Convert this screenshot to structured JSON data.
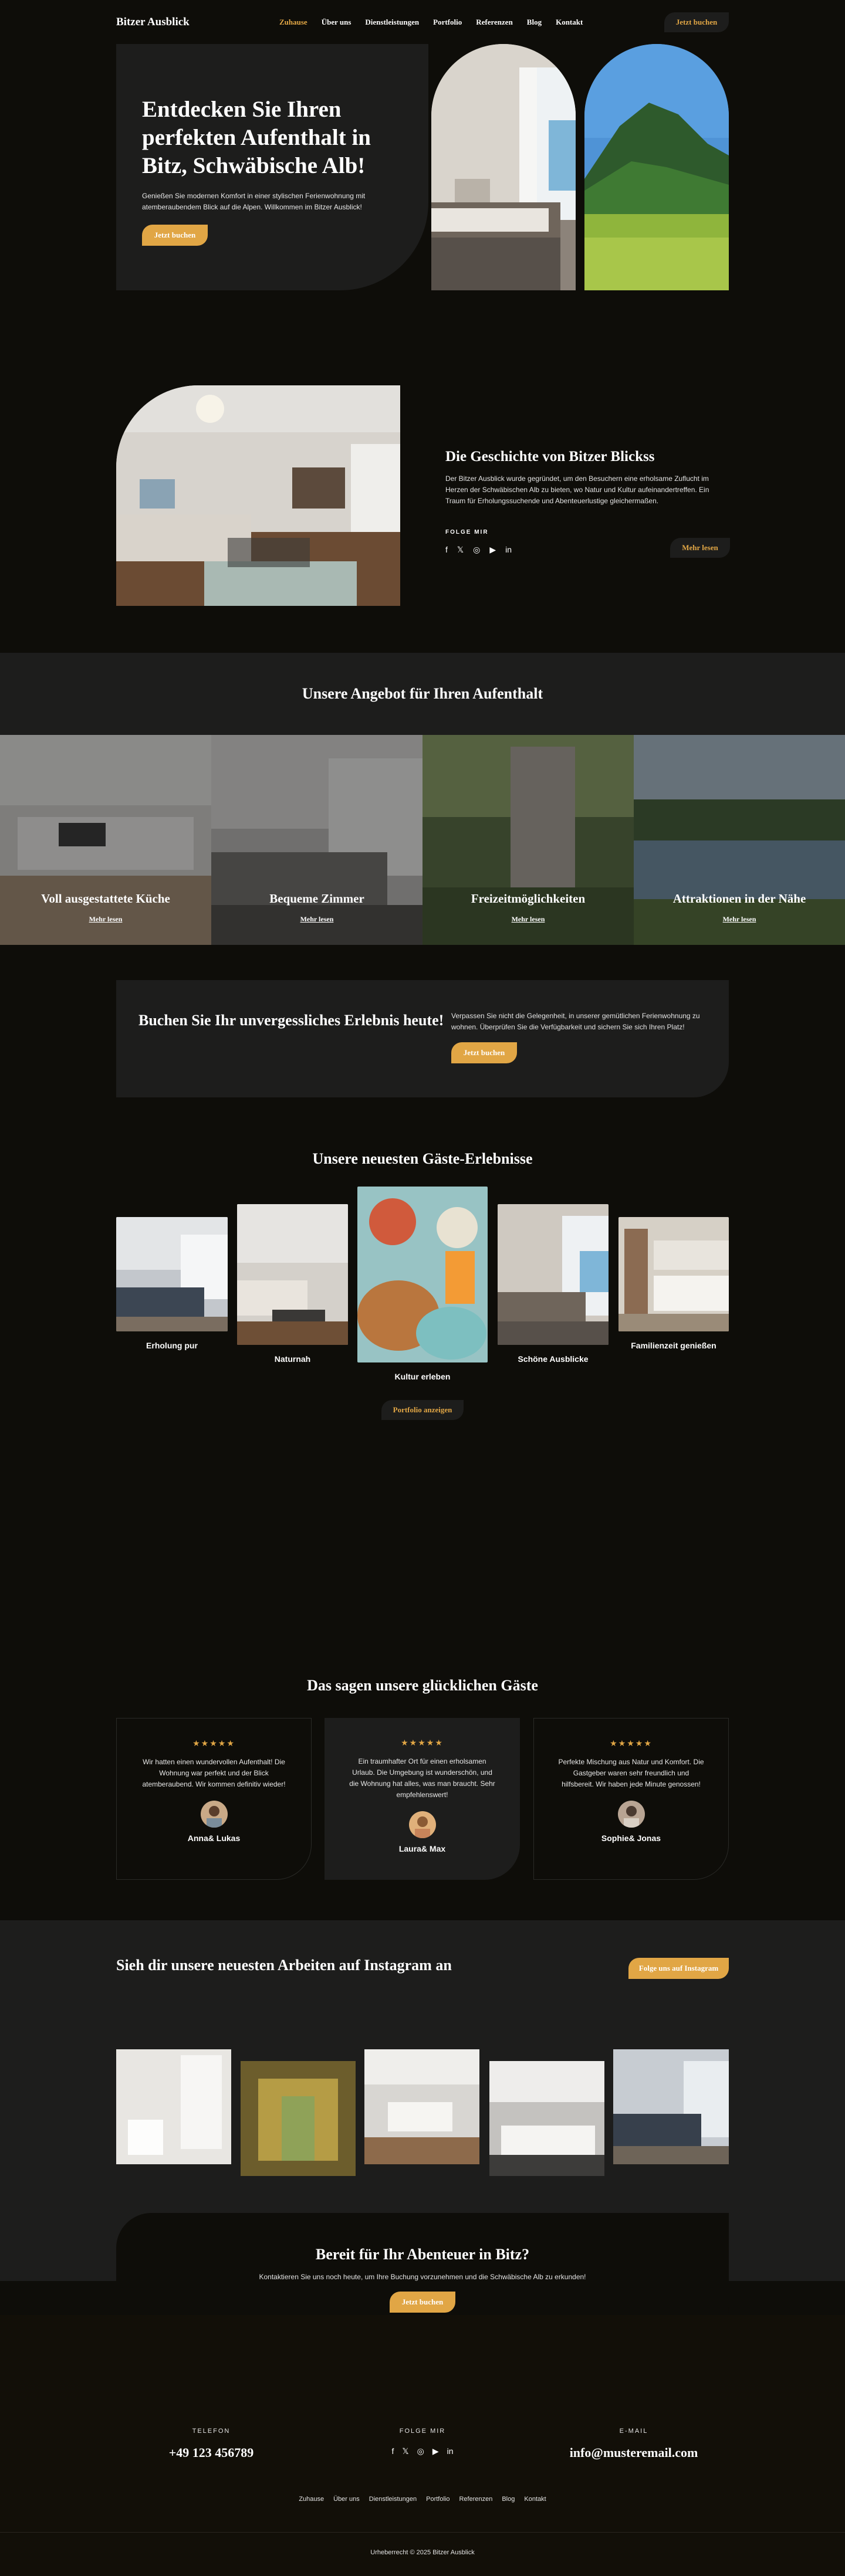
{
  "header": {
    "logo": "Bitzer Ausblick",
    "nav": [
      "Zuhause",
      "Über uns",
      "Dienstleistungen",
      "Portfolio",
      "Referenzen",
      "Blog",
      "Kontakt"
    ],
    "cta": "Jetzt buchen"
  },
  "hero": {
    "title": "Entdecken Sie Ihren perfekten Aufenthalt in Bitz, Schwäbische Alb!",
    "text": "Genießen Sie modernen Komfort in einer stylischen Ferienwohnung mit atemberaubendem Blick auf die Alpen. Willkommen im Bitzer Ausblick!",
    "button": "Jetzt buchen"
  },
  "story": {
    "title": "Die Geschichte von Bitzer Blickss",
    "text": "Der Bitzer Ausblick wurde gegründet, um den Besuchern eine erholsame Zuflucht im Herzen der Schwäbischen Alb zu bieten, wo Natur und Kultur aufeinandertreffen. Ein Traum für Erholungssuchende und Abenteuerlustige gleichermaßen.",
    "follow_label": "FOLGE MIR",
    "button": "Mehr lesen",
    "socials": [
      "facebook-icon",
      "x-icon",
      "instagram-icon",
      "youtube-icon",
      "linkedin-icon"
    ]
  },
  "offers": {
    "title": "Unsere Angebot für Ihren Aufenthalt",
    "tiles": [
      {
        "title": "Voll ausgestattete Küche",
        "link": "Mehr lesen"
      },
      {
        "title": "Bequeme Zimmer",
        "link": "Mehr lesen"
      },
      {
        "title": "Freizeitmöglichkeiten",
        "link": "Mehr lesen"
      },
      {
        "title": "Attraktionen in der Nähe",
        "link": "Mehr lesen"
      }
    ]
  },
  "booking": {
    "title": "Buchen Sie Ihr unvergessliches Erlebnis heute!",
    "text": "Verpassen Sie nicht die Gelegenheit, in unserer gemütlichen Ferienwohnung zu wohnen. Überprüfen Sie die Verfügbarkeit und sichern Sie sich Ihren Platz!",
    "button": "Jetzt buchen"
  },
  "experiences": {
    "title": "Unsere neuesten Gäste-Erlebnisse",
    "items": [
      "Erholung pur",
      "Naturnah",
      "Kultur erleben",
      "Schöne Ausblicke",
      "Familienzeit genießen"
    ],
    "button": "Portfolio anzeigen"
  },
  "testimonials": {
    "title": "Das sagen unsere glücklichen Gäste",
    "cards": [
      {
        "stars": "★★★★★",
        "text": "Wir hatten einen wundervollen Aufenthalt! Die Wohnung war perfekt und der Blick atemberaubend. Wir kommen definitiv wieder!",
        "name": "Anna& Lukas"
      },
      {
        "stars": "★★★★★",
        "text": "Ein traumhafter Ort für einen erholsamen Urlaub. Die Umgebung ist wunderschön, und die Wohnung hat alles, was man braucht. Sehr empfehlenswert!",
        "name": "Laura& Max"
      },
      {
        "stars": "★★★★★",
        "text": "Perfekte Mischung aus Natur und Komfort. Die Gastgeber waren sehr freundlich und hilfsbereit. Wir haben jede Minute genossen!",
        "name": "Sophie& Jonas"
      }
    ]
  },
  "instagram": {
    "title": "Sieh dir unsere neuesten Arbeiten auf Instagram an",
    "button": "Folge uns auf Instagram"
  },
  "final_cta": {
    "title": "Bereit für Ihr Abenteuer in Bitz?",
    "text": "Kontaktieren Sie uns noch heute, um Ihre Buchung vorzunehmen und die Schwäbische Alb zu erkunden!",
    "button": "Jetzt buchen"
  },
  "footer": {
    "phone_label": "TELEFON",
    "phone": "+49 123 456789",
    "follow_label": "FOLGE MIR",
    "email_label": "E-MAIL",
    "email": "info@musteremail.com",
    "links": [
      "Zuhause",
      "Über uns",
      "Dienstleistungen",
      "Portfolio",
      "Referenzen",
      "Blog",
      "Kontakt"
    ],
    "copyright": "Urheberrecht © 2025 Bitzer Ausblick"
  },
  "colors": {
    "accent": "#e1a645",
    "background": "#0e0d09",
    "panel": "#1d1d1c"
  }
}
